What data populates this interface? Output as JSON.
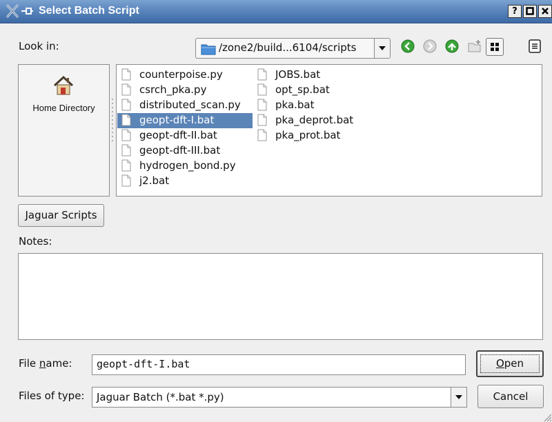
{
  "window": {
    "title": "Select Batch Script",
    "title_buttons": [
      "?",
      "□",
      "×"
    ]
  },
  "look_in": {
    "label": "Look in:",
    "path": "/zone2/build...6104/scripts",
    "nav_icons": [
      "back-icon",
      "forward-icon",
      "up-icon",
      "new-folder-icon",
      "icon-view-icon",
      "detail-view-icon"
    ]
  },
  "sidebar": {
    "items": [
      {
        "label": "Home Directory",
        "icon": "home-icon"
      }
    ]
  },
  "files": {
    "col1": [
      "counterpoise.py",
      "csrch_pka.py",
      "distributed_scan.py",
      "geopt-dft-I.bat",
      "geopt-dft-II.bat",
      "geopt-dft-III.bat",
      "hydrogen_bond.py",
      "j2.bat"
    ],
    "col2": [
      "JOBS.bat",
      "opt_sp.bat",
      "pka.bat",
      "pka_deprot.bat",
      "pka_prot.bat"
    ],
    "selected": "geopt-dft-I.bat"
  },
  "jaguar_button": "Jaguar Scripts",
  "notes": {
    "label": "Notes:",
    "value": ""
  },
  "filename": {
    "label_pre": "File ",
    "label_u": "n",
    "label_post": "ame:",
    "value": "geopt-dft-I.bat"
  },
  "filetype": {
    "label": "Files of type:",
    "value": "Jaguar Batch (*.bat *.py)"
  },
  "buttons": {
    "open_u": "O",
    "open_rest": "pen",
    "cancel": "Cancel"
  },
  "colors": {
    "titlebar": "#4f7bb4",
    "selection": "#5b84b7",
    "nav_green": "#3aa53a",
    "folder_blue": "#4a8fd8"
  }
}
